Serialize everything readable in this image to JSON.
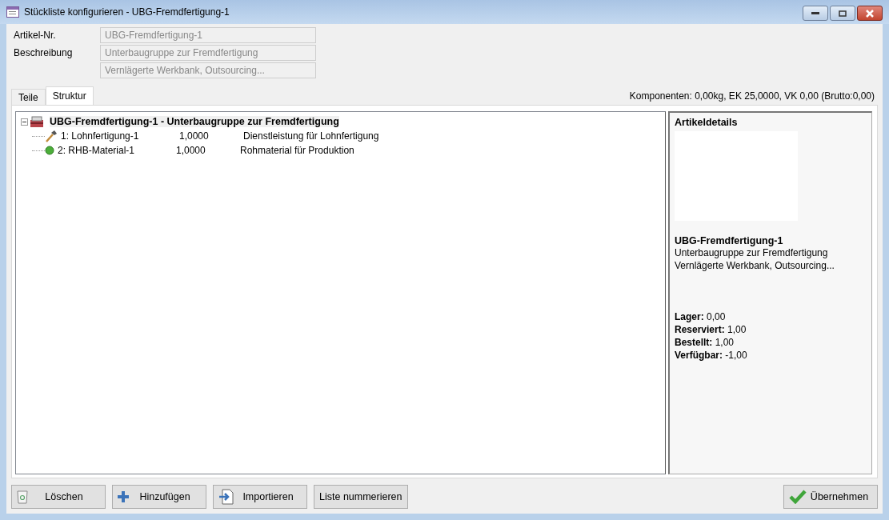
{
  "window": {
    "title": "Stückliste konfigurieren - UBG-Fremdfertigung-1"
  },
  "fields": [
    {
      "label": "Artikel-Nr.",
      "value": "UBG-Fremdfertigung-1",
      "disabled": true
    },
    {
      "label": "Beschreibung",
      "value": "Unterbaugruppe zur Fremdfertigung",
      "disabled": true
    },
    {
      "value": "Vernlägerte Werkbank, Outsourcing...",
      "disabled": true
    }
  ],
  "tabs": [
    {
      "label": "Teile",
      "selected": false
    },
    {
      "label": "Struktur",
      "selected": true
    }
  ],
  "summary": "Komponenten: 0,00kg, EK 25,0000, VK 0,00 (Brutto:0,00)",
  "tree": {
    "label": "UBG-Fremdfertigung-1 - Unterbaugruppe zur Fremdfertigung",
    "expanded": true,
    "selected": true,
    "children": [
      {
        "kind": "service",
        "selected": false,
        "name": "1: Lohnfertigung-1",
        "quantity": "1,0000",
        "description": "Dienstleistung für Lohnfertigung"
      },
      {
        "kind": "material",
        "selected": false,
        "name": "2: RHB-Material-1",
        "quantity": "1,0000",
        "description": "Rohmaterial für Produktion"
      }
    ]
  },
  "details": {
    "title": "Artikeldetails",
    "name": "UBG-Fremdfertigung-1",
    "lines": [
      "Unterbaugruppe zur Fremdfertigung",
      "Vernlägerte Werkbank, Outsourcing..."
    ],
    "stock": [
      {
        "label": "Lager:",
        "value": "0,00"
      },
      {
        "label": "Reserviert:",
        "value": "1,00"
      },
      {
        "label": "Bestellt:",
        "value": "1,00"
      },
      {
        "label": "Verfügbar:",
        "value": "-1,00"
      }
    ]
  },
  "buttons": [
    {
      "kind": "delete",
      "label": "Löschen"
    },
    {
      "kind": "add",
      "label": "Hinzufügen"
    },
    {
      "kind": "import",
      "label": "Importieren"
    },
    {
      "kind": "plain",
      "label": "Liste nummerieren"
    }
  ],
  "confirm": {
    "label": "Übernehmen"
  }
}
